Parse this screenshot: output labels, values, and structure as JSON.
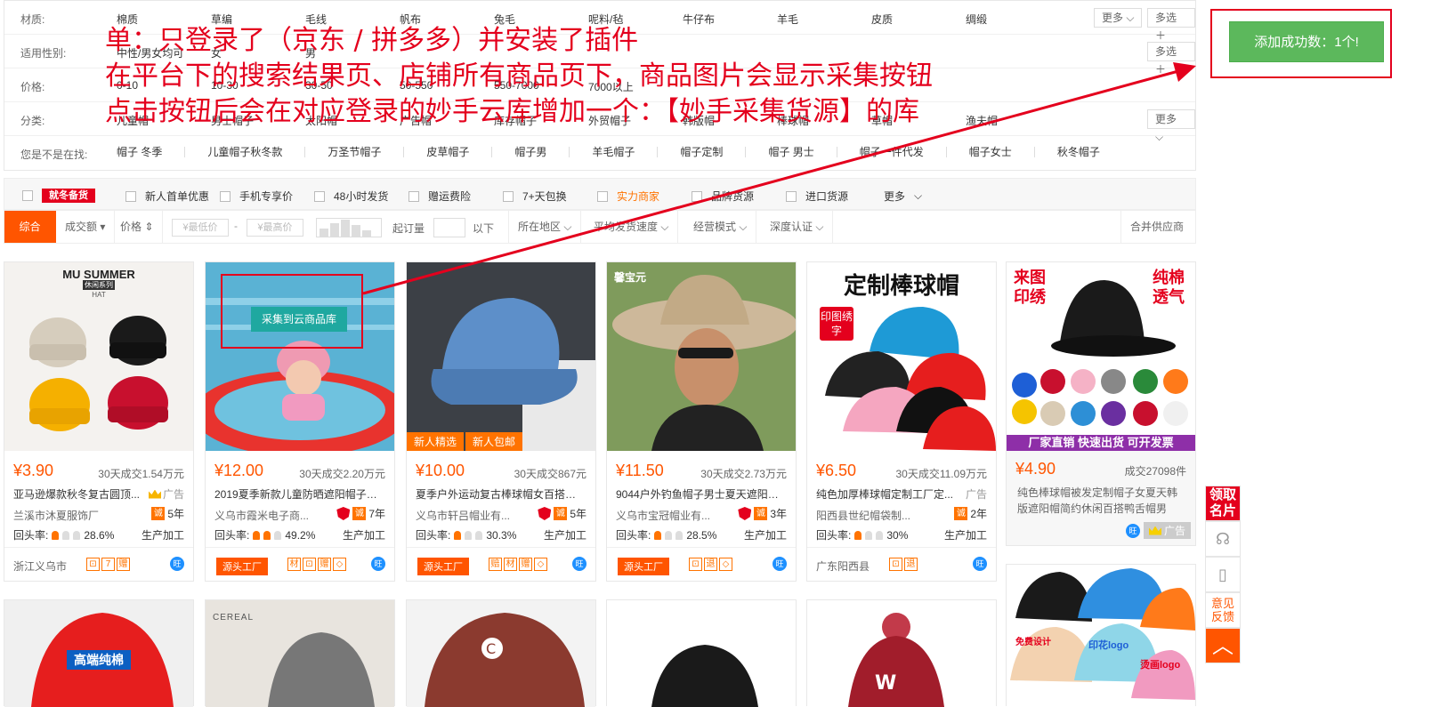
{
  "filters": {
    "material": {
      "label": "材质:",
      "options": [
        "棉质",
        "草编",
        "毛线",
        "帆布",
        "兔毛",
        "呢料/毡",
        "牛仔布",
        "羊毛",
        "皮质",
        "绸缎"
      ]
    },
    "gender": {
      "label": "适用性别:",
      "options": [
        "中性/男女均可",
        "女",
        "男"
      ]
    },
    "price": {
      "label": "价格:",
      "options": [
        "0-10",
        "10-30",
        "30-50",
        "50-550",
        "550-7000",
        "7000以上"
      ]
    },
    "category": {
      "label": "分类:",
      "options": [
        "儿童帽",
        "男士帽子",
        "太阳帽",
        "广告帽",
        "库存帽子",
        "外贸帽子",
        "韩版帽",
        "棒球帽",
        "草帽",
        "渔夫帽"
      ]
    },
    "suggest": {
      "label": "您是不是在找:",
      "options": [
        "帽子 冬季",
        "儿童帽子秋冬款",
        "万圣节帽子",
        "皮草帽子",
        "帽子男",
        "羊毛帽子",
        "帽子定制",
        "帽子 男士",
        "帽子一件代发",
        "帽子女士",
        "秋冬帽子"
      ]
    },
    "more_label": "更多",
    "multi_label": "多选"
  },
  "checks": {
    "promo_badge": "就冬备货",
    "items": [
      "新人首单优惠",
      "手机专享价",
      "48小时发货",
      "赠运费险",
      "7+天包换",
      "实力商家",
      "品牌货源",
      "进口货源"
    ],
    "more_label": "更多"
  },
  "sort": {
    "comprehensive": "综合",
    "turnover": "成交额",
    "price": "价格",
    "min_price": "¥最低价",
    "max_price": "¥最高价",
    "dash": "-",
    "moq": "起订量",
    "below": "以下",
    "region": "所在地区",
    "ship_speed": "平均发货速度",
    "mode": "经营模式",
    "cert": "深度认证",
    "merge": "合并供应商"
  },
  "annotation": {
    "line1": "单：只登录了（京东 / 拼多多）并安装了插件",
    "line2": "在平台下的搜索结果页、店铺所有商品页下，商品图片会显示采集按钮",
    "line3": "点击按钮后会在对应登录的妙手云库增加一个：【妙手采集货源】的库"
  },
  "success_button": "添加成功数：1个!",
  "collect_button": "采集到云商品库",
  "products": [
    {
      "price": "¥3.90",
      "sales": "30天成交1.54万元",
      "title": "亚马逊爆款秋冬复古圆顶...",
      "ad": "广告",
      "shop": "兰溪市沐夏服饰厂",
      "years": "5年",
      "repeat_label": "回头率:",
      "repeat": "28.6%",
      "mode": "生产加工",
      "region": "浙江义乌市",
      "img_text": "MU SUMMER",
      "img_sub": "休闲系列",
      "img_hat": "HAT"
    },
    {
      "price": "¥12.00",
      "sales": "30天成交2.20万元",
      "title": "2019夏季新款儿童防晒遮阳帽子透...",
      "ad": "",
      "shop": "义乌市霞米电子商...",
      "years": "7年",
      "repeat_label": "回头率:",
      "repeat": "49.2%",
      "mode": "生产加工",
      "factory": "源头工厂"
    },
    {
      "price": "¥10.00",
      "sales": "30天成交867元",
      "title": "夏季户外运动复古棒球帽女百搭配...",
      "ad": "",
      "shop": "义乌市轩吕帽业有...",
      "years": "5年",
      "repeat_label": "回头率:",
      "repeat": "30.3%",
      "mode": "生产加工",
      "factory": "源头工厂",
      "tags": [
        "新人精选",
        "新人包邮"
      ]
    },
    {
      "price": "¥11.50",
      "sales": "30天成交2.73万元",
      "title": "9044户外钓鱼帽子男士夏天遮阳防...",
      "ad": "",
      "shop": "义乌市宝冠帽业有...",
      "years": "3年",
      "repeat_label": "回头率:",
      "repeat": "28.5%",
      "mode": "生产加工",
      "factory": "源头工厂",
      "img_text": "馨宝元"
    },
    {
      "price": "¥6.50",
      "sales": "30天成交11.09万元",
      "title": "纯色加厚棒球帽定制工厂定...",
      "ad": "广告",
      "shop": "阳西县世纪帽袋制...",
      "years": "2年",
      "repeat_label": "回头率:",
      "repeat": "30%",
      "mode": "生产加工",
      "region": "广东阳西县",
      "img_text": "定制棒球帽",
      "img_sub": "印图绣字"
    },
    {
      "price": "¥4.90",
      "sales": "成交27098件",
      "title": "纯色棒球帽被发定制帽子女夏天韩版遮阳帽简约休闲百搭鸭舌帽男",
      "ad": "广告",
      "img_left": "来图印绣",
      "img_right": "纯棉透气",
      "img_banner": "厂家直销 快速出货 可开发票"
    }
  ],
  "row2": {
    "img1": "高端纯棉",
    "img2": "CEREAL",
    "img6a": "免费设计",
    "img6b": "印花logo",
    "img6c": "烫画logo"
  },
  "sidebar": {
    "card": "领取名片",
    "feedback": "意见反馈",
    "top": "︿"
  },
  "colors": {
    "accent": "#ff5500",
    "annotation": "#e4001d",
    "success": "#5cb85c",
    "collect": "#1fa8a0"
  }
}
